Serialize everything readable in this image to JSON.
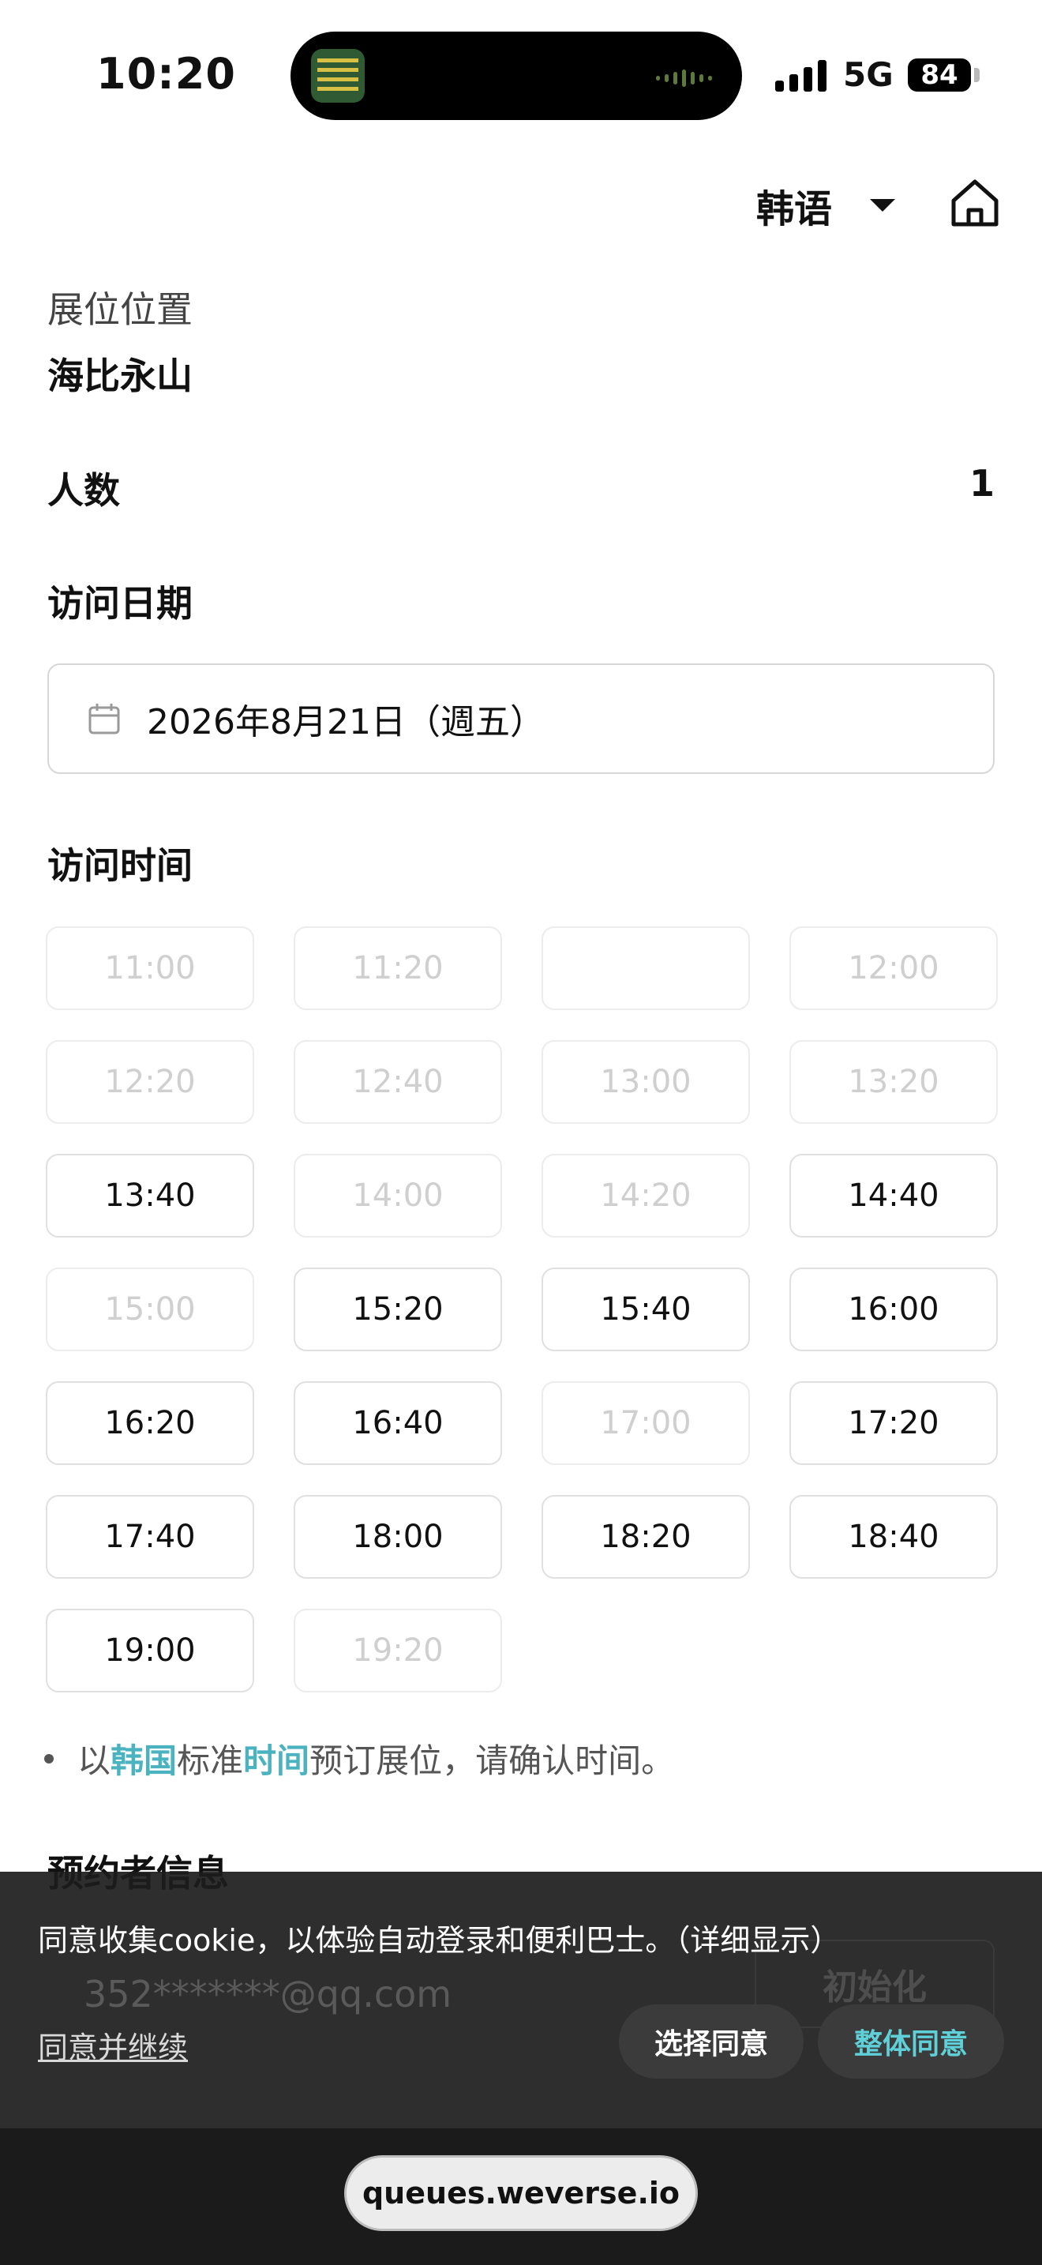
{
  "status_bar": {
    "time": "10:20",
    "network": "5G",
    "battery": "84"
  },
  "header": {
    "language": "韩语",
    "icons": [
      "chevron-down-icon",
      "home-icon"
    ]
  },
  "booth": {
    "location_label": "展位位置",
    "location_value": "海比永山",
    "people_label": "人数",
    "people_value": "1"
  },
  "visit_date": {
    "title": "访问日期",
    "value": "2026年8月21日（週五）",
    "icon": "calendar-icon"
  },
  "visit_time": {
    "title": "访问时间",
    "slots": [
      {
        "time": "11:00",
        "available": false
      },
      {
        "time": "11:20",
        "available": false
      },
      {
        "time": "",
        "available": false
      },
      {
        "time": "12:00",
        "available": false
      },
      {
        "time": "12:20",
        "available": false
      },
      {
        "time": "12:40",
        "available": false
      },
      {
        "time": "13:00",
        "available": false
      },
      {
        "time": "13:20",
        "available": false
      },
      {
        "time": "13:40",
        "available": true
      },
      {
        "time": "14:00",
        "available": false
      },
      {
        "time": "14:20",
        "available": false
      },
      {
        "time": "14:40",
        "available": true
      },
      {
        "time": "15:00",
        "available": false
      },
      {
        "time": "15:20",
        "available": true
      },
      {
        "time": "15:40",
        "available": true
      },
      {
        "time": "16:00",
        "available": true
      },
      {
        "time": "16:20",
        "available": true
      },
      {
        "time": "16:40",
        "available": true
      },
      {
        "time": "17:00",
        "available": false
      },
      {
        "time": "17:20",
        "available": true
      },
      {
        "time": "17:40",
        "available": true
      },
      {
        "time": "18:00",
        "available": true
      },
      {
        "time": "18:20",
        "available": true
      },
      {
        "time": "18:40",
        "available": true
      },
      {
        "time": "19:00",
        "available": true
      },
      {
        "time": "19:20",
        "available": false
      }
    ]
  },
  "notice": {
    "pre": "以",
    "hl1": "韩国",
    "mid": "标准",
    "hl2": "时间",
    "post": "预订展位，请确认时间。"
  },
  "booker": {
    "title": "预约者信息",
    "email": "352*******@qq.com",
    "reset_label": "初始化"
  },
  "cookie_banner": {
    "text": "同意收集cookie，以体验自动登录和便利巴士。（详细显示）",
    "continue_link": "同意并继续",
    "select_button": "选择同意",
    "all_button": "整体同意"
  },
  "browser": {
    "url": "queues.weverse.io"
  },
  "colors": {
    "accent": "#4bb3c0",
    "cookie_accent": "#5fd0d8",
    "disabled_text": "#cfcfcf"
  }
}
